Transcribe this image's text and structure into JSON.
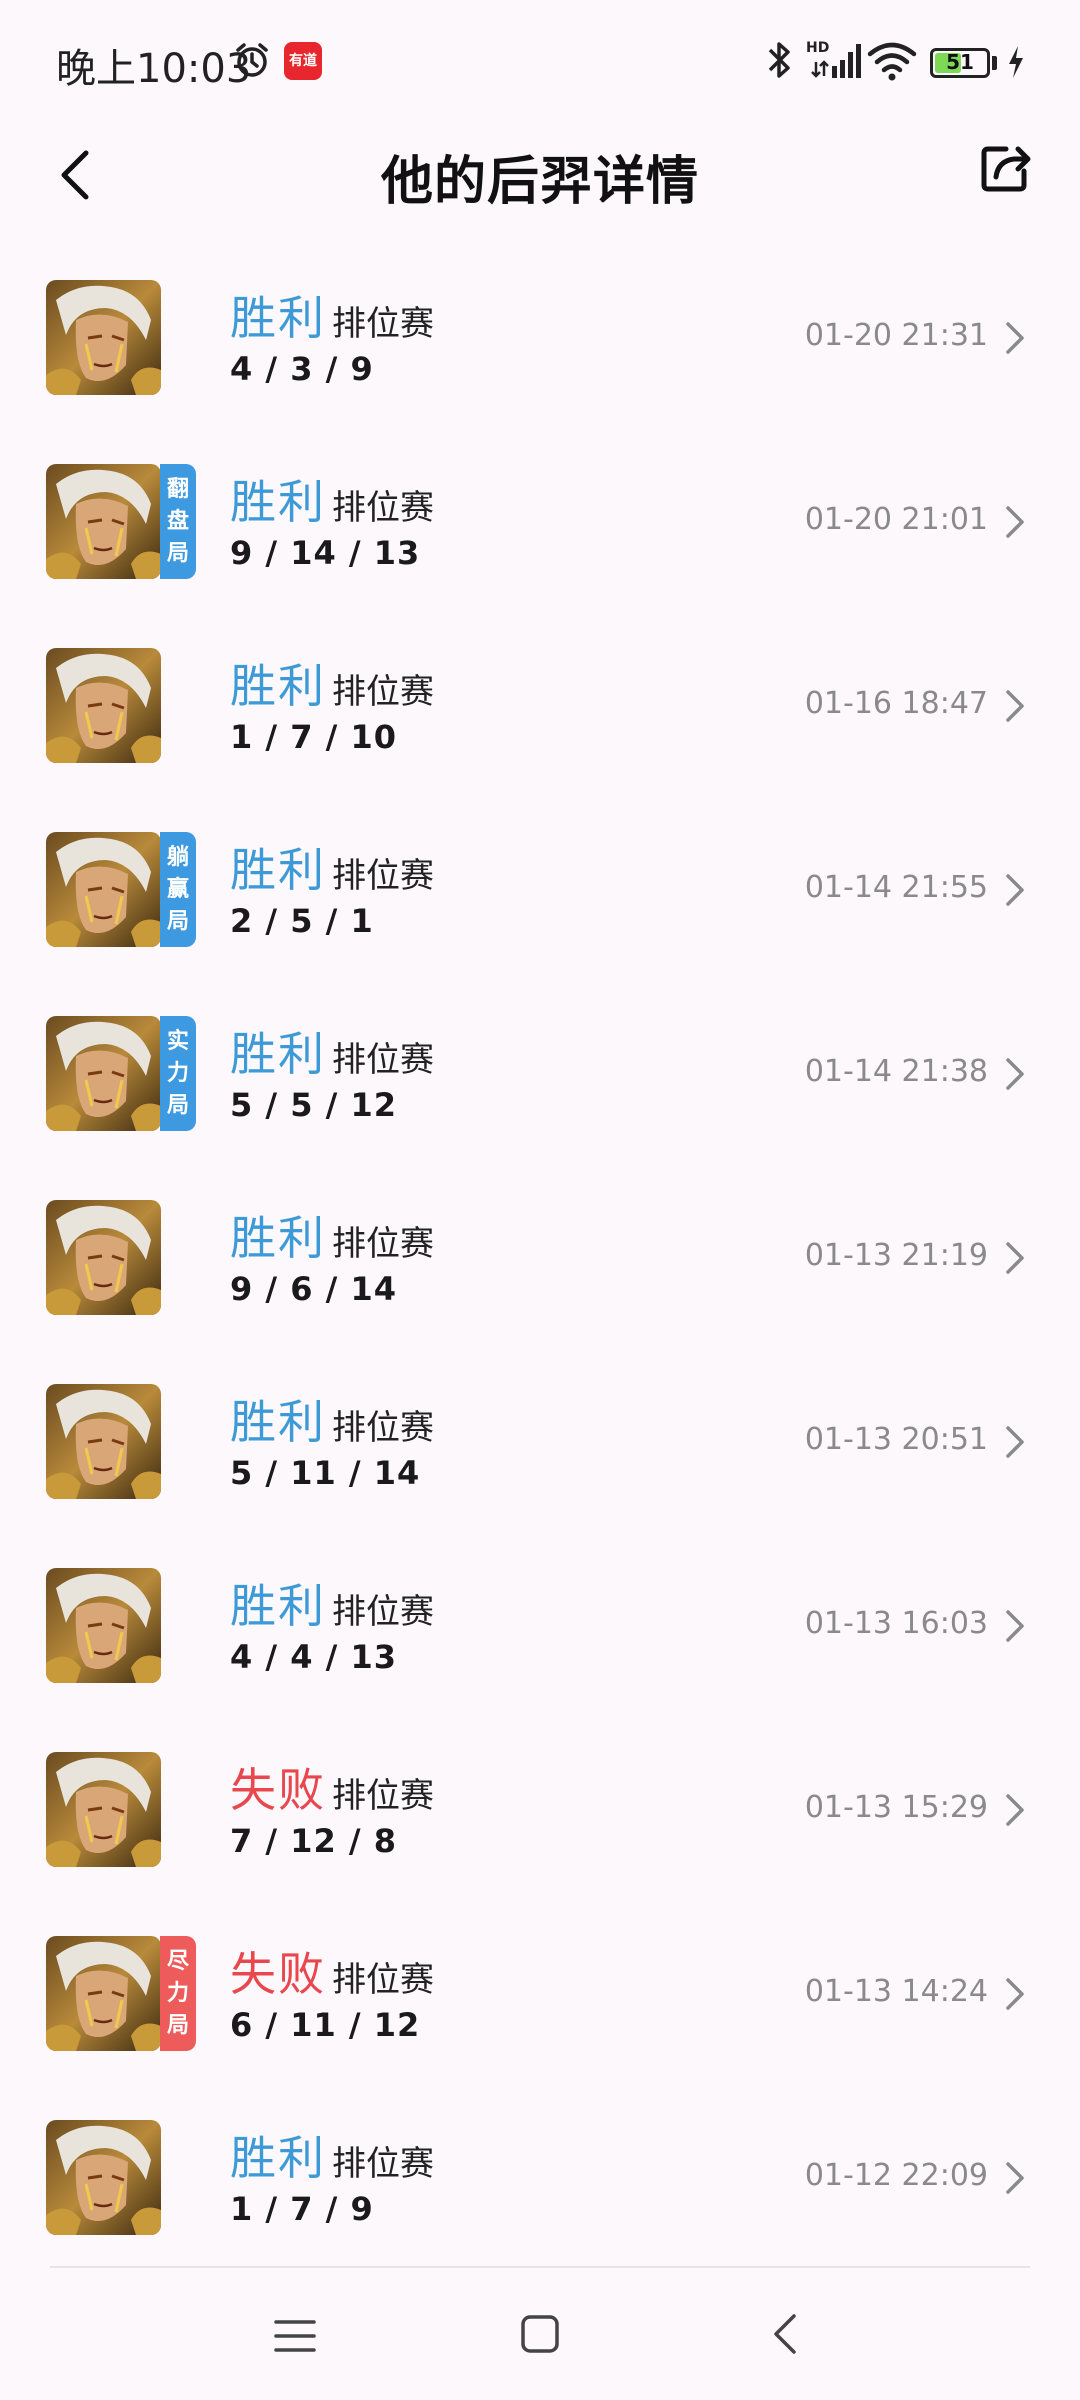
{
  "status_bar": {
    "time": "晚上10:03",
    "app_badge": "有道",
    "network": "HD",
    "battery": "51",
    "battery_level": 0.51
  },
  "header": {
    "title": "他的后羿详情",
    "back_icon": "chevron-left-icon",
    "share_icon": "share-icon"
  },
  "matches": [
    {
      "result": "胜利",
      "outcome": "win",
      "mode": "排位赛",
      "kda": "4 / 3 / 9",
      "time": "01-20 21:31",
      "tag": ""
    },
    {
      "result": "胜利",
      "outcome": "win",
      "mode": "排位赛",
      "kda": "9 / 14 / 13",
      "time": "01-20 21:01",
      "tag": "翻盘局",
      "tag_color": "blue"
    },
    {
      "result": "胜利",
      "outcome": "win",
      "mode": "排位赛",
      "kda": "1 / 7 / 10",
      "time": "01-16 18:47",
      "tag": ""
    },
    {
      "result": "胜利",
      "outcome": "win",
      "mode": "排位赛",
      "kda": "2 / 5 / 1",
      "time": "01-14 21:55",
      "tag": "躺赢局",
      "tag_color": "blue"
    },
    {
      "result": "胜利",
      "outcome": "win",
      "mode": "排位赛",
      "kda": "5 / 5 / 12",
      "time": "01-14 21:38",
      "tag": "实力局",
      "tag_color": "blue"
    },
    {
      "result": "胜利",
      "outcome": "win",
      "mode": "排位赛",
      "kda": "9 / 6 / 14",
      "time": "01-13 21:19",
      "tag": ""
    },
    {
      "result": "胜利",
      "outcome": "win",
      "mode": "排位赛",
      "kda": "5 / 11 / 14",
      "time": "01-13 20:51",
      "tag": ""
    },
    {
      "result": "胜利",
      "outcome": "win",
      "mode": "排位赛",
      "kda": "4 / 4 / 13",
      "time": "01-13 16:03",
      "tag": ""
    },
    {
      "result": "失败",
      "outcome": "loss",
      "mode": "排位赛",
      "kda": "7 / 12 / 8",
      "time": "01-13 15:29",
      "tag": ""
    },
    {
      "result": "失败",
      "outcome": "loss",
      "mode": "排位赛",
      "kda": "6 / 11 / 12",
      "time": "01-13 14:24",
      "tag": "尽力局",
      "tag_color": "red"
    },
    {
      "result": "胜利",
      "outcome": "win",
      "mode": "排位赛",
      "kda": "1 / 7 / 9",
      "time": "01-12 22:09",
      "tag": ""
    }
  ],
  "colors": {
    "win": "#3d9ad6",
    "loss": "#e8474d",
    "tag_blue": "#3d9ae0",
    "tag_red": "#ee5b5b",
    "time": "#8a8a8a",
    "background": "#fcf8fc"
  },
  "nav_bar": {
    "menu_icon": "menu-icon",
    "home_icon": "home-icon",
    "back_icon": "back-triangle-icon"
  }
}
